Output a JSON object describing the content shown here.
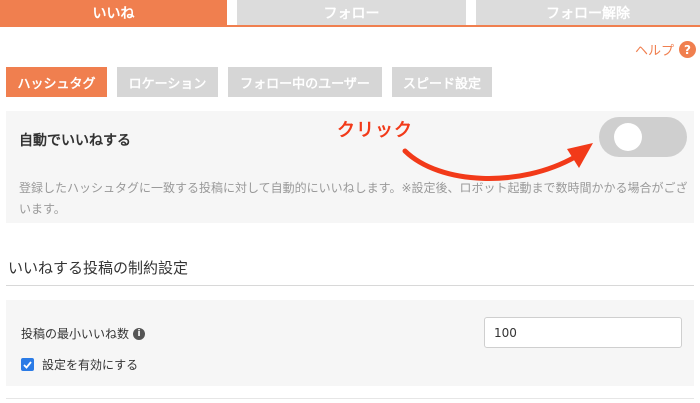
{
  "top_tabs": [
    {
      "label": "いいね",
      "active": true
    },
    {
      "label": "フォロー",
      "active": false
    },
    {
      "label": "フォロー解除",
      "active": false
    }
  ],
  "help": {
    "label": "ヘルプ",
    "icon": "question-icon",
    "glyph": "?"
  },
  "sub_tabs": [
    {
      "label": "ハッシュタグ",
      "active": true
    },
    {
      "label": "ロケーション",
      "active": false
    },
    {
      "label": "フォロー中のユーザー",
      "active": false
    },
    {
      "label": "スピード設定",
      "active": false
    }
  ],
  "auto_like": {
    "title": "自動でいいねする",
    "toggle_on": false,
    "description": "登録したハッシュタグに一致する投稿に対して自動的にいいねします。※設定後、ロボット起動まで数時間かかる場合がございます。"
  },
  "annotation": {
    "label": "クリック"
  },
  "restrictions": {
    "title": "いいねする投稿の制約設定",
    "min_likes_label": "投稿の最小いいね数",
    "info_glyph": "i",
    "min_likes_value": "100",
    "enable_label": "設定を有効にする",
    "enable_checked": true
  },
  "colors": {
    "accent": "#f07f4f",
    "annotation": "#f23a19",
    "checkbox": "#2b7be6"
  }
}
